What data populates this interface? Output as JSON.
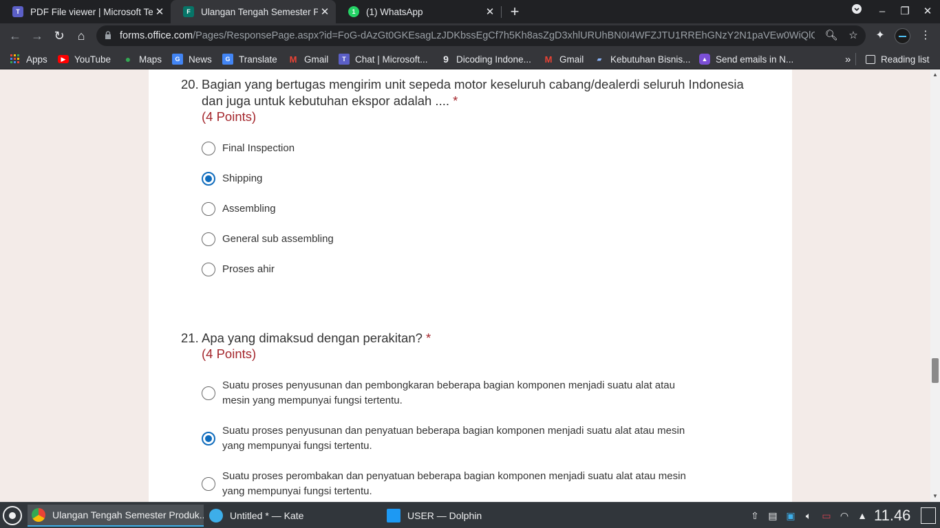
{
  "tabs": [
    {
      "title": "PDF File viewer | Microsoft Te",
      "icon": "teams-icon",
      "color": "#5b5fc7",
      "active": false
    },
    {
      "title": "Ulangan Tengah Semester Pr",
      "icon": "forms-icon",
      "color": "#077568",
      "active": true
    },
    {
      "title": "(1) WhatsApp",
      "icon": "whatsapp-icon",
      "color": "#25d366",
      "active": false
    }
  ],
  "omnibox": {
    "host": "forms.office.com",
    "path": "/Pages/ResponsePage.aspx?id=FoG-dAzGt0GKEsagLzJDKbssEgCf7h5Kh8asZgD3xhlURUhBN0I4WFZJTU1RREhGNzY2N1paVEw0WiQlQC..."
  },
  "bookmarks": [
    {
      "label": "Apps",
      "icon": "apps-grid-icon"
    },
    {
      "label": "YouTube",
      "icon": "youtube-icon"
    },
    {
      "label": "Maps",
      "icon": "maps-icon"
    },
    {
      "label": "News",
      "icon": "news-icon"
    },
    {
      "label": "Translate",
      "icon": "translate-icon"
    },
    {
      "label": "Gmail",
      "icon": "gmail-icon"
    },
    {
      "label": "Chat | Microsoft...",
      "icon": "teams-icon"
    },
    {
      "label": "Dicoding Indone...",
      "icon": "dicoding-icon"
    },
    {
      "label": "Gmail",
      "icon": "gmail-icon"
    },
    {
      "label": "Kebutuhan Bisnis...",
      "icon": "bisnis-icon"
    },
    {
      "label": "Send emails in N...",
      "icon": "rocket-icon"
    }
  ],
  "reading_list": "Reading list",
  "questions": [
    {
      "number": "20.",
      "title": "Bagian yang bertugas mengirim unit sepeda motor keseluruh cabang/dealerdi seluruh Indonesia dan juga untuk kebutuhan ekspor adalah ....",
      "required": "*",
      "points": "(4 Points)",
      "options": [
        {
          "label": "Final Inspection",
          "checked": false
        },
        {
          "label": "Shipping",
          "checked": true
        },
        {
          "label": "Assembling",
          "checked": false
        },
        {
          "label": "General sub assembling",
          "checked": false
        },
        {
          "label": "Proses ahir",
          "checked": false
        }
      ]
    },
    {
      "number": "21.",
      "title": "Apa yang dimaksud dengan perakitan?",
      "required": "*",
      "points": "(4 Points)",
      "options": [
        {
          "label": "Suatu proses penyusunan dan pembongkaran beberapa bagian komponen menjadi suatu alat atau mesin yang mempunyai fungsi tertentu.",
          "checked": false
        },
        {
          "label": "Suatu proses penyusunan dan penyatuan beberapa bagian komponen menjadi suatu alat atau mesin yang mempunyai fungsi tertentu.",
          "checked": true
        },
        {
          "label": "Suatu proses perombakan dan penyatuan beberapa bagian komponen menjadi suatu alat atau mesin yang mempunyai fungsi tertentu.",
          "checked": false
        }
      ]
    }
  ],
  "taskbar": {
    "tasks": [
      {
        "label": "Ulangan Tengah Semester Produk...",
        "icon": "chrome-icon",
        "active": true
      },
      {
        "label": "Untitled * — Kate",
        "icon": "kate-icon",
        "active": false
      },
      {
        "label": "USER — Dolphin",
        "icon": "dolphin-icon",
        "active": false
      }
    ],
    "clock": "11.46"
  },
  "colors": {
    "accent": "#0f6cbd",
    "required": "#a4262c",
    "page_bg": "#f3ebe8"
  }
}
